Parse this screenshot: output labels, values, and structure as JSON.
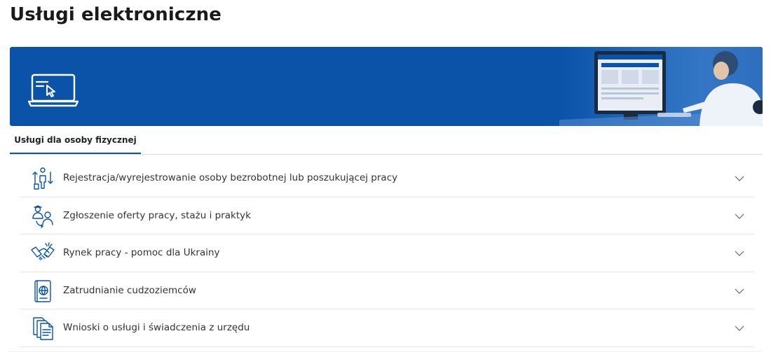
{
  "page": {
    "title": "Usługi elektroniczne"
  },
  "banner": {
    "icon": "laptop-cursor-icon",
    "background_color": "#0a53a9"
  },
  "tabs": [
    {
      "label": "Usługi dla osoby fizycznej",
      "active": true
    }
  ],
  "services": [
    {
      "label": "Rejestracja/wyrejestrowanie osoby bezrobotnej lub poszukującej pracy",
      "icon": "registration-icon"
    },
    {
      "label": "Zgłoszenie oferty pracy, stażu i praktyk",
      "icon": "job-offer-icon"
    },
    {
      "label": "Rynek pracy - pomoc dla Ukrainy",
      "icon": "handshake-icon"
    },
    {
      "label": "Zatrudnianie cudzoziemców",
      "icon": "passport-icon"
    },
    {
      "label": "Wnioski o usługi i świadczenia z urzędu",
      "icon": "documents-icon"
    }
  ],
  "colors": {
    "accent": "#0a53a9",
    "text": "#333333"
  }
}
